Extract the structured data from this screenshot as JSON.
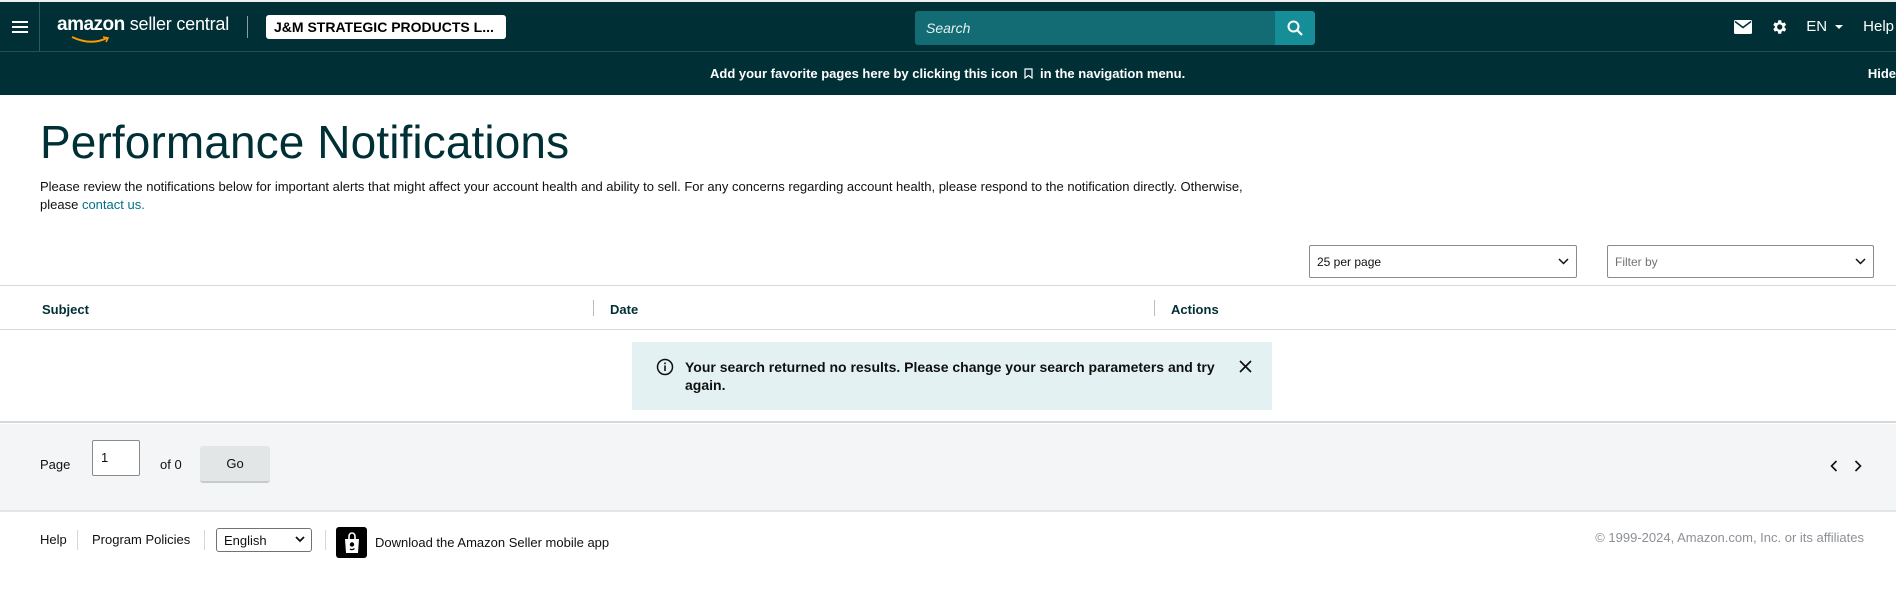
{
  "topbar": {
    "logo_amazon": "amazon",
    "logo_seller_central": "seller central",
    "store_name": "J&M STRATEGIC PRODUCTS L...",
    "search_placeholder": "Search",
    "lang": "EN",
    "help": "Help"
  },
  "favbar": {
    "message_before": "Add your favorite pages here by clicking this icon",
    "message_after": "in the navigation menu.",
    "hide": "Hide"
  },
  "page": {
    "title": "Performance Notifications",
    "description": "Please review the notifications below for important alerts that might affect your account health and ability to sell. For any concerns regarding account health, please respond to the notification directly. Otherwise, please",
    "contact_link": "contact us.",
    "per_page": "25 per page",
    "filter_placeholder": "Filter by"
  },
  "table": {
    "columns": [
      "Subject",
      "Date",
      "Actions"
    ],
    "empty_message": "Your search returned no results. Please change your search parameters and try again."
  },
  "pager": {
    "page_label": "Page",
    "page_value": "1",
    "of_label": "of 0",
    "go_label": "Go"
  },
  "footer": {
    "help": "Help",
    "program_policies": "Program Policies",
    "language": "English",
    "app_text": "Download the Amazon Seller mobile app",
    "copyright": "© 1999-2024, Amazon.com, Inc. or its affiliates"
  },
  "colors": {
    "nav_bg": "#002f36",
    "search_bg": "#136b74",
    "search_btn": "#168e97",
    "link": "#007185",
    "alert_bg": "#e3f1f2"
  },
  "icons": [
    "menu-icon",
    "search-icon",
    "mail-icon",
    "gear-icon",
    "caret-down-icon",
    "bookmark-icon",
    "info-icon",
    "close-icon",
    "chevron-left-icon",
    "chevron-right-icon",
    "amazon-app-icon"
  ]
}
